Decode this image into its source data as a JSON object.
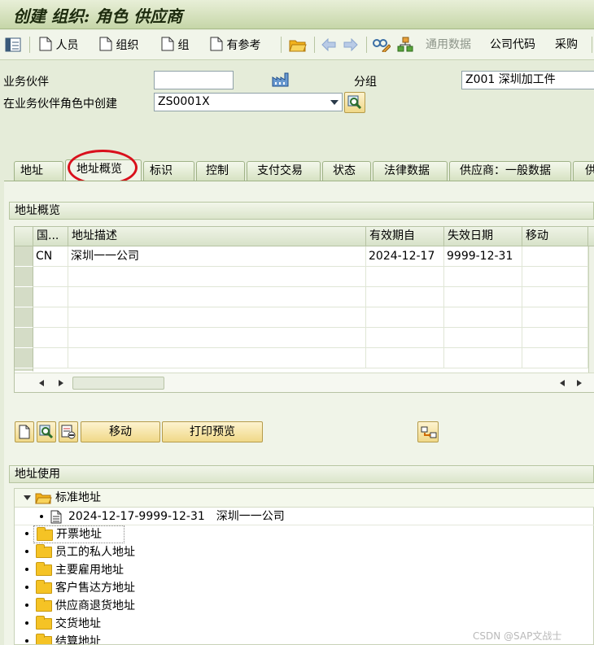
{
  "window": {
    "title": "创建 组织: 角色 供应商"
  },
  "toolbar": {
    "person": "人员",
    "org": "组织",
    "group": "组",
    "with_ref": "有参考",
    "general_data": "通用数据",
    "company_code": "公司代码",
    "purchasing": "采购"
  },
  "header": {
    "bp_label": "业务伙伴",
    "bp_value": "",
    "grouping_label": "分组",
    "grouping_value": "Z001 深圳加工件",
    "role_label": "在业务伙伴角色中创建",
    "role_value": "ZS0001X"
  },
  "tabs": [
    "地址",
    "地址概览",
    "标识",
    "控制",
    "支付交易",
    "状态",
    "法律数据",
    "供应商：一般数据",
    "供"
  ],
  "address_overview": {
    "title": "地址概览",
    "columns": [
      "国...",
      "地址描述",
      "有效期自",
      "失效日期",
      "移动"
    ],
    "rows": [
      {
        "country": "CN",
        "description": "深圳一一公司",
        "valid_from": "2024-12-17",
        "valid_to": "9999-12-31",
        "move": ""
      }
    ],
    "move_button": "移动",
    "print_preview_button": "打印预览"
  },
  "address_usage": {
    "title": "地址使用",
    "root": "标准地址",
    "root_child": "2024-12-17-9999-12-31　深圳一一公司",
    "items": [
      "开票地址",
      "员工的私人地址",
      "主要雇用地址",
      "客户售达方地址",
      "供应商退货地址",
      "交货地址",
      "结算地址"
    ]
  },
  "watermark": "CSDN @SAP文战士"
}
